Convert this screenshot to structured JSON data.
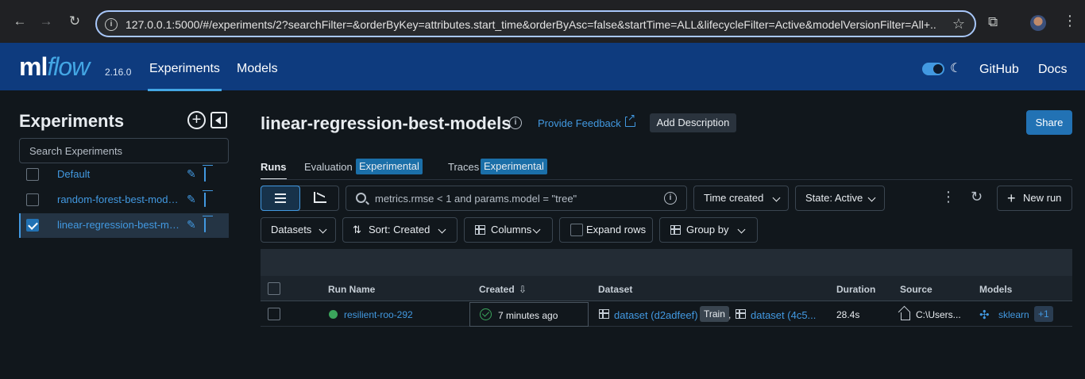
{
  "browser": {
    "url": "127.0.0.1:5000/#/experiments/2?searchFilter=&orderByKey=attributes.start_time&orderByAsc=false&startTime=ALL&lifecycleFilter=Active&modelVersionFilter=All+..."
  },
  "header": {
    "logo_ml": "ml",
    "logo_flow": "flow",
    "version": "2.16.0",
    "nav": [
      "Experiments",
      "Models"
    ],
    "links": [
      "GitHub",
      "Docs"
    ]
  },
  "sidebar": {
    "title": "Experiments",
    "search_placeholder": "Search Experiments",
    "items": [
      {
        "label": "Default",
        "checked": false
      },
      {
        "label": "random-forest-best-models",
        "checked": false
      },
      {
        "label": "linear-regression-best-models",
        "checked": true
      }
    ]
  },
  "main": {
    "title": "linear-regression-best-models",
    "feedback_label": "Provide Feedback",
    "add_description_label": "Add Description",
    "share_label": "Share",
    "tabs": [
      {
        "label": "Runs",
        "tag": ""
      },
      {
        "label": "Evaluation",
        "tag": "Experimental"
      },
      {
        "label": "Traces",
        "tag": "Experimental"
      }
    ],
    "search_placeholder": "metrics.rmse < 1 and params.model = \"tree\"",
    "time_created_label": "Time created",
    "state_label": "State: Active",
    "new_run_label": "New run",
    "datasets_label": "Datasets",
    "sort_label": "Sort: Created",
    "columns_label": "Columns",
    "expand_rows_label": "Expand rows",
    "group_by_label": "Group by"
  },
  "table": {
    "columns": [
      "Run Name",
      "Created",
      "Dataset",
      "Duration",
      "Source",
      "Models"
    ],
    "rows": [
      {
        "run_name": "resilient-roo-292",
        "created": "7 minutes ago",
        "dataset_1": "dataset (d2adfeef)",
        "dataset_1_tag": "Train",
        "separator": ",",
        "dataset_2": "dataset (4c5...",
        "duration": "28.4s",
        "source": "C:\\Users...",
        "model": "sklearn",
        "model_more": "+1"
      }
    ]
  },
  "colors": {
    "header_bg": "#0e3b7e",
    "accent": "#4299e1",
    "page_bg": "#11171c",
    "success": "#3ba55c"
  }
}
